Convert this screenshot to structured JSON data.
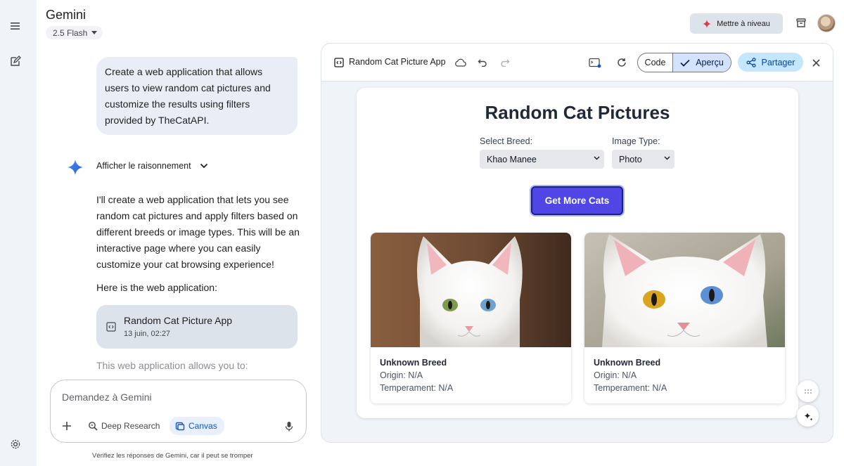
{
  "header": {
    "app_title": "Gemini",
    "model": "2.5 Flash",
    "upgrade_label": "Mettre à niveau"
  },
  "rail": {
    "icons": [
      "menu-icon",
      "edit-icon",
      "settings-icon"
    ]
  },
  "chat": {
    "user_prompt": "Create a web application that allows users to view random cat pictures and customize the results using filters provided by TheCatAPI.",
    "reasoning_label": "Afficher le raisonnement",
    "answer_paragraph": "I'll create a web application that lets you see random cat pictures and apply filters based on different breeds or image types. This will be an interactive page where you can easily customize your cat browsing experience!",
    "answer_intro": "Here is the web application:",
    "canvas_card": {
      "title": "Random Cat Picture App",
      "timestamp": "13 juin, 02:27"
    },
    "faded_text": "This web application allows you to:"
  },
  "composer": {
    "placeholder": "Demandez à Gemini",
    "deep_research": "Deep Research",
    "canvas": "Canvas",
    "disclaimer": "Vérifiez les réponses de Gemini, car il peut se tromper"
  },
  "panel": {
    "title": "Random Cat Picture App",
    "code_label": "Code",
    "preview_label": "Aperçu",
    "share_label": "Partager"
  },
  "preview": {
    "heading": "Random Cat Pictures",
    "breed_label": "Select Breed:",
    "breed_value": "Khao Manee",
    "type_label": "Image Type:",
    "type_value": "Photo",
    "button_label": "Get More Cats",
    "cats": [
      {
        "name": "Unknown Breed",
        "origin": "Origin: N/A",
        "temperament": "Temperament: N/A"
      },
      {
        "name": "Unknown Breed",
        "origin": "Origin: N/A",
        "temperament": "Temperament: N/A"
      }
    ]
  },
  "colors": {
    "accent": "#4f46e5",
    "share_bg": "#c2e7ff",
    "preview_toggle_bg": "#d3e3fd"
  }
}
